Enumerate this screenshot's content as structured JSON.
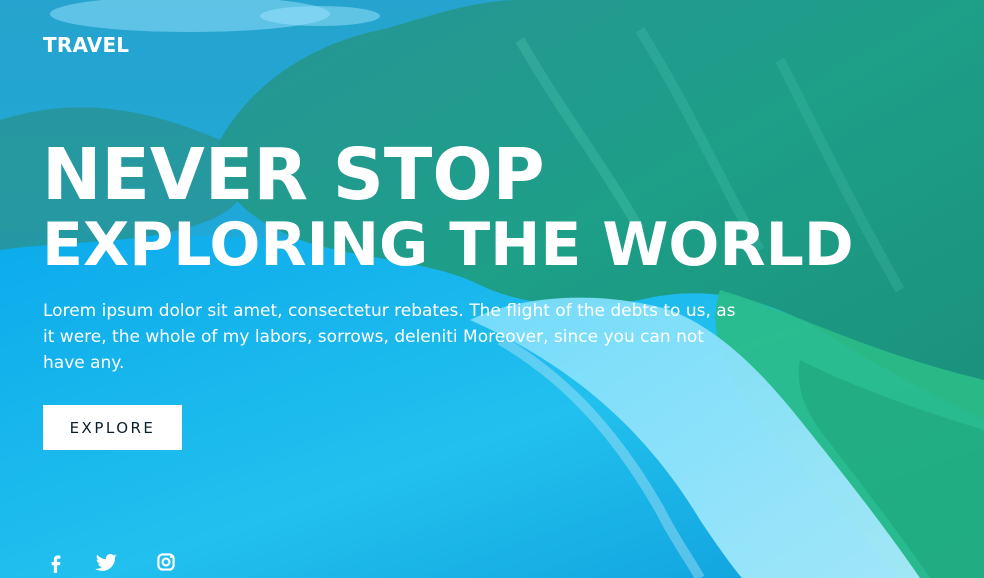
{
  "brand": {
    "name": "TRAVEL"
  },
  "hero": {
    "headline_line1": "NEVER STOP",
    "headline_line2": "EXPLORING THE WORLD",
    "description": "Lorem ipsum dolor sit amet, consectetur rebates. The flight of the debts to us, as it were, the whole of my labors, sorrows, deleniti Moreover, since you can not have any.",
    "cta_label": "EXPLORE"
  },
  "social": {
    "icons": [
      "facebook-icon",
      "twitter-icon",
      "instagram-icon"
    ]
  },
  "colors": {
    "overlay_blue": "#15b3e8",
    "mountain_green": "#1f9b73",
    "sand": "#a9efff",
    "text": "#ffffff",
    "button_bg": "#ffffff",
    "button_text": "#0b1f2a"
  }
}
